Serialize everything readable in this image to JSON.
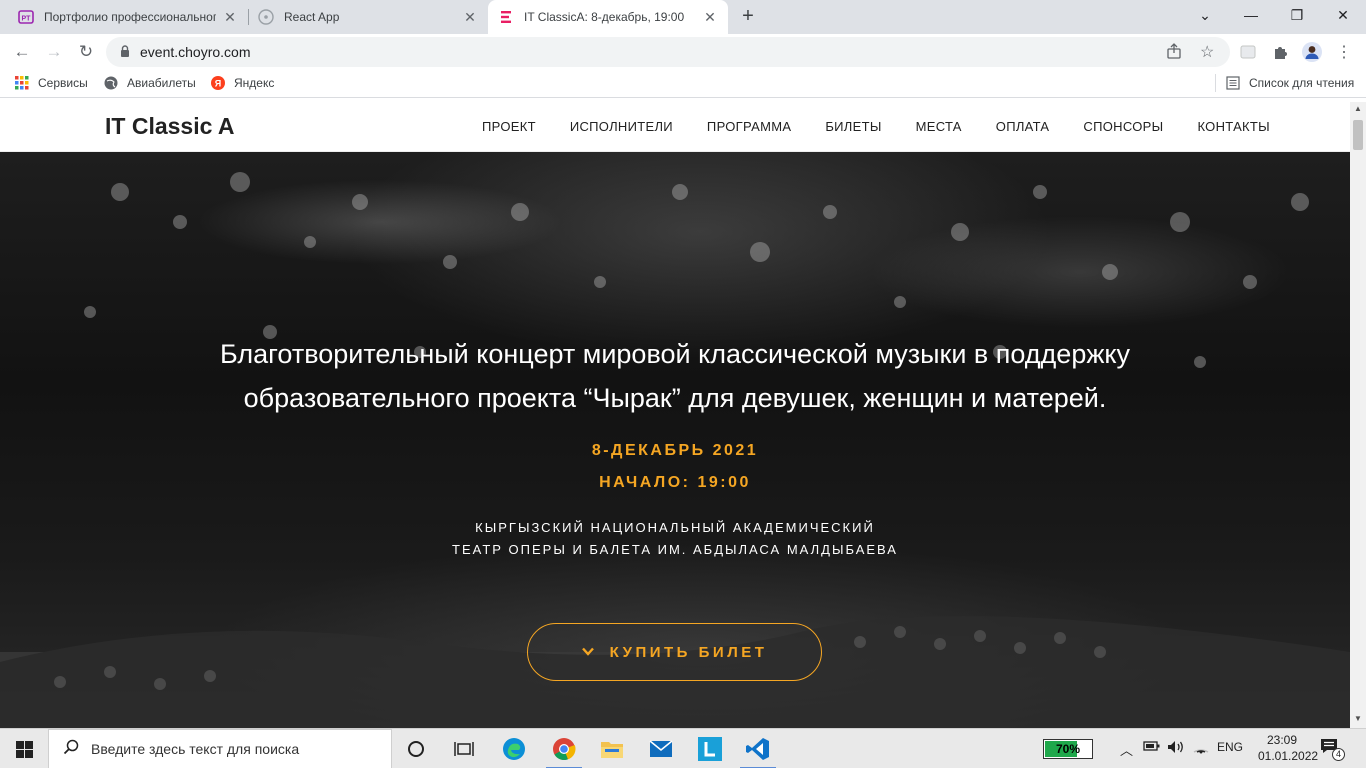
{
  "browser": {
    "tabs": [
      {
        "title": "Портфолио профессионального",
        "favicon": "purple-logo-icon"
      },
      {
        "title": "React App",
        "favicon": "react-icon"
      },
      {
        "title": "IT ClassicA: 8-декабрь, 19:00",
        "favicon": "pink-e-icon",
        "active": true
      }
    ],
    "new_tab": "+",
    "window": {
      "minimize": "⌄",
      "restore": "—",
      "maximize": "❐",
      "close": "✕"
    },
    "nav": {
      "back": "←",
      "forward": "→",
      "reload": "↻"
    },
    "url": "event.choyro.com",
    "bookmarks": [
      {
        "label": "Сервисы",
        "icon": "apps-grid-icon"
      },
      {
        "label": "Авиабилеты",
        "icon": "globe-icon"
      },
      {
        "label": "Яндекс",
        "icon": "yandex-icon"
      }
    ],
    "reading_list": "Список для чтения"
  },
  "site": {
    "logo": "IT Classic A",
    "menu": [
      "ПРОЕКТ",
      "ИСПОЛНИТЕЛИ",
      "ПРОГРАММА",
      "БИЛЕТЫ",
      "МЕСТА",
      "ОПЛАТА",
      "СПОНСОРЫ",
      "КОНТАКТЫ"
    ]
  },
  "hero": {
    "title_line1": "Благотворительный концерт мировой классической музыки в поддержку",
    "title_line2": "образовательного проекта “Чырак” для девушек, женщин и матерей.",
    "date": "8-ДЕКАБРЬ 2021",
    "time": "НАЧАЛО: 19:00",
    "venue_line1": "КЫРГЫЗСКИЙ НАЦИОНАЛЬНЫЙ АКАДЕМИЧЕСКИЙ",
    "venue_line2": "ТЕАТР ОПЕРЫ И БАЛЕТА ИМ. АБДЫЛАСА МАЛДЫБАЕВА",
    "button": "КУПИТЬ БИЛЕТ",
    "accent_color": "#f5a623"
  },
  "taskbar": {
    "search_placeholder": "Введите здесь текст для поиска",
    "battery_percent": 70,
    "battery_label": "70%",
    "language": "ENG",
    "time": "23:09",
    "date": "01.01.2022",
    "notifications": "4"
  }
}
